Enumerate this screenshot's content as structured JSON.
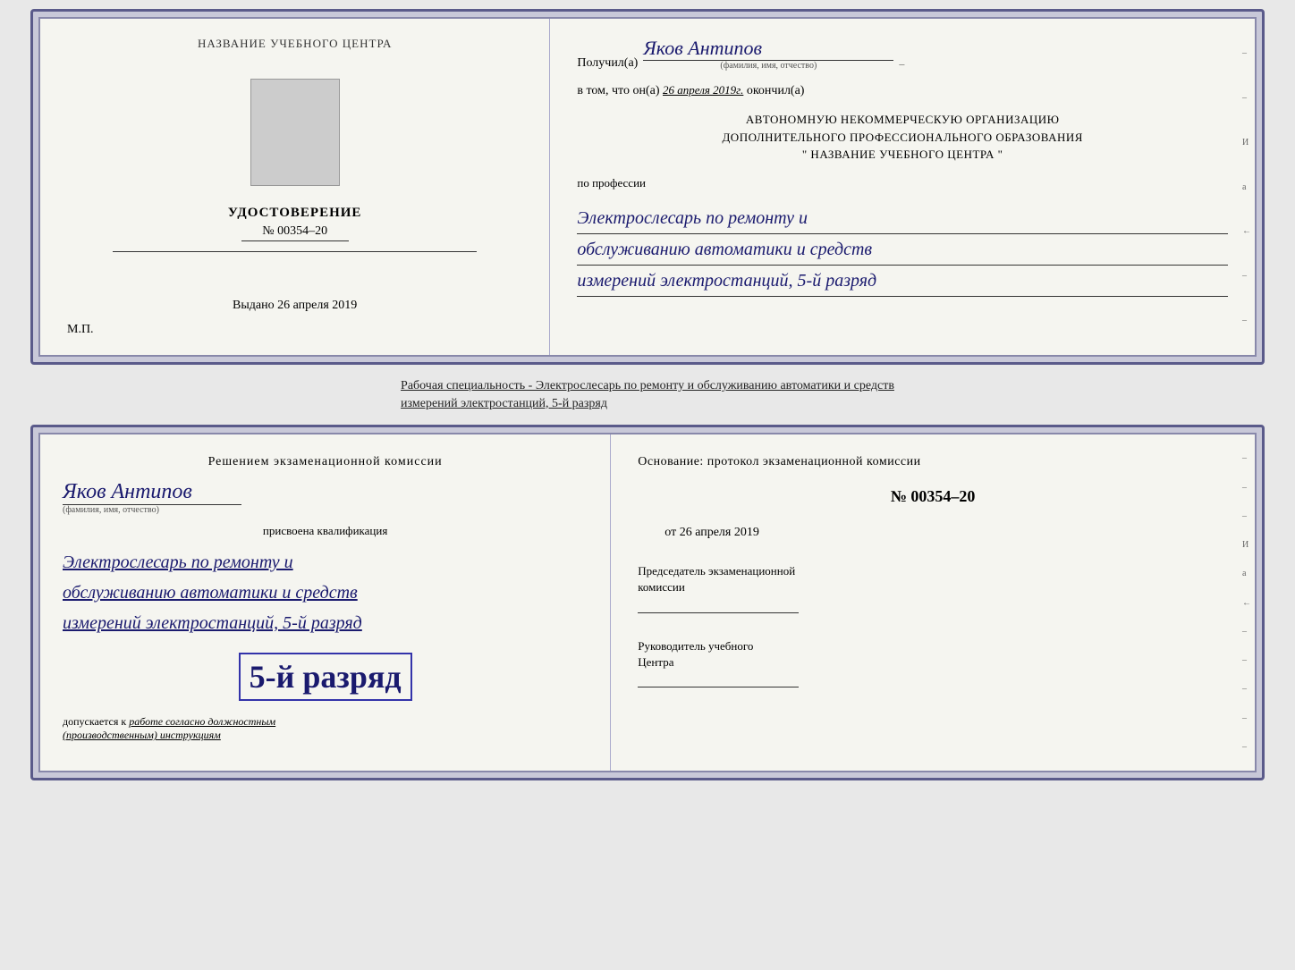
{
  "upper_doc": {
    "left": {
      "org_name": "НАЗВАНИЕ УЧЕБНОГО ЦЕНТРА",
      "udostoverenie_title": "УДОСТОВЕРЕНИЕ",
      "number": "№ 00354–20",
      "issued_label": "Выдано",
      "issued_date": "26 апреля 2019",
      "mp_label": "М.П."
    },
    "right": {
      "received_label": "Получил(а)",
      "received_name": "Яков Антипов",
      "fio_sublabel": "(фамилия, имя, отчество)",
      "vtom_prefix": "в том, что он(а)",
      "vtom_date": "26 апреля 2019г.",
      "vtom_suffix": "окончил(а)",
      "org_line1": "АВТОНОМНУЮ НЕКОММЕРЧЕСКУЮ ОРГАНИЗАЦИЮ",
      "org_line2": "ДОПОЛНИТЕЛЬНОГО ПРОФЕССИОНАЛЬНОГО ОБРАЗОВАНИЯ",
      "org_line3": "\" НАЗВАНИЕ УЧЕБНОГО ЦЕНТРА \"",
      "profession_label": "по профессии",
      "profession_line1": "Электрослесарь по ремонту и",
      "profession_line2": "обслуживанию автоматики и средств",
      "profession_line3": "измерений электростанций, 5-й разряд"
    }
  },
  "between_text": {
    "line1": "Рабочая специальность - Электрослесарь по ремонту и обслуживанию автоматики и средств",
    "line2": "измерений электростанций, 5-й разряд"
  },
  "lower_doc": {
    "left": {
      "decision_text": "Решением экзаменационной комиссии",
      "person_name": "Яков Антипов",
      "fio_sublabel": "(фамилия, имя, отчество)",
      "assigned_label": "присвоена квалификация",
      "qual_line1": "Электрослесарь по ремонту и",
      "qual_line2": "обслуживанию автоматики и средств",
      "qual_line3": "измерений электростанций, 5-й разряд",
      "rank_text": "5-й разряд",
      "dopusk_prefix": "допускается к",
      "dopusk_italic": "работе согласно должностным",
      "dopusk_italic2": "(производственным) инструкциям"
    },
    "right": {
      "osnov_text": "Основание: протокол экзаменационной комиссии",
      "protocol_number": "№ 00354–20",
      "from_label": "от",
      "from_date": "26 апреля 2019",
      "chairman_label": "Председатель экзаменационной\nкомиссии",
      "director_label": "Руководитель учебного\nЦентра",
      "edge_marks": [
        "И",
        "а",
        "←",
        "–",
        "–",
        "–",
        "–",
        "–"
      ]
    }
  }
}
